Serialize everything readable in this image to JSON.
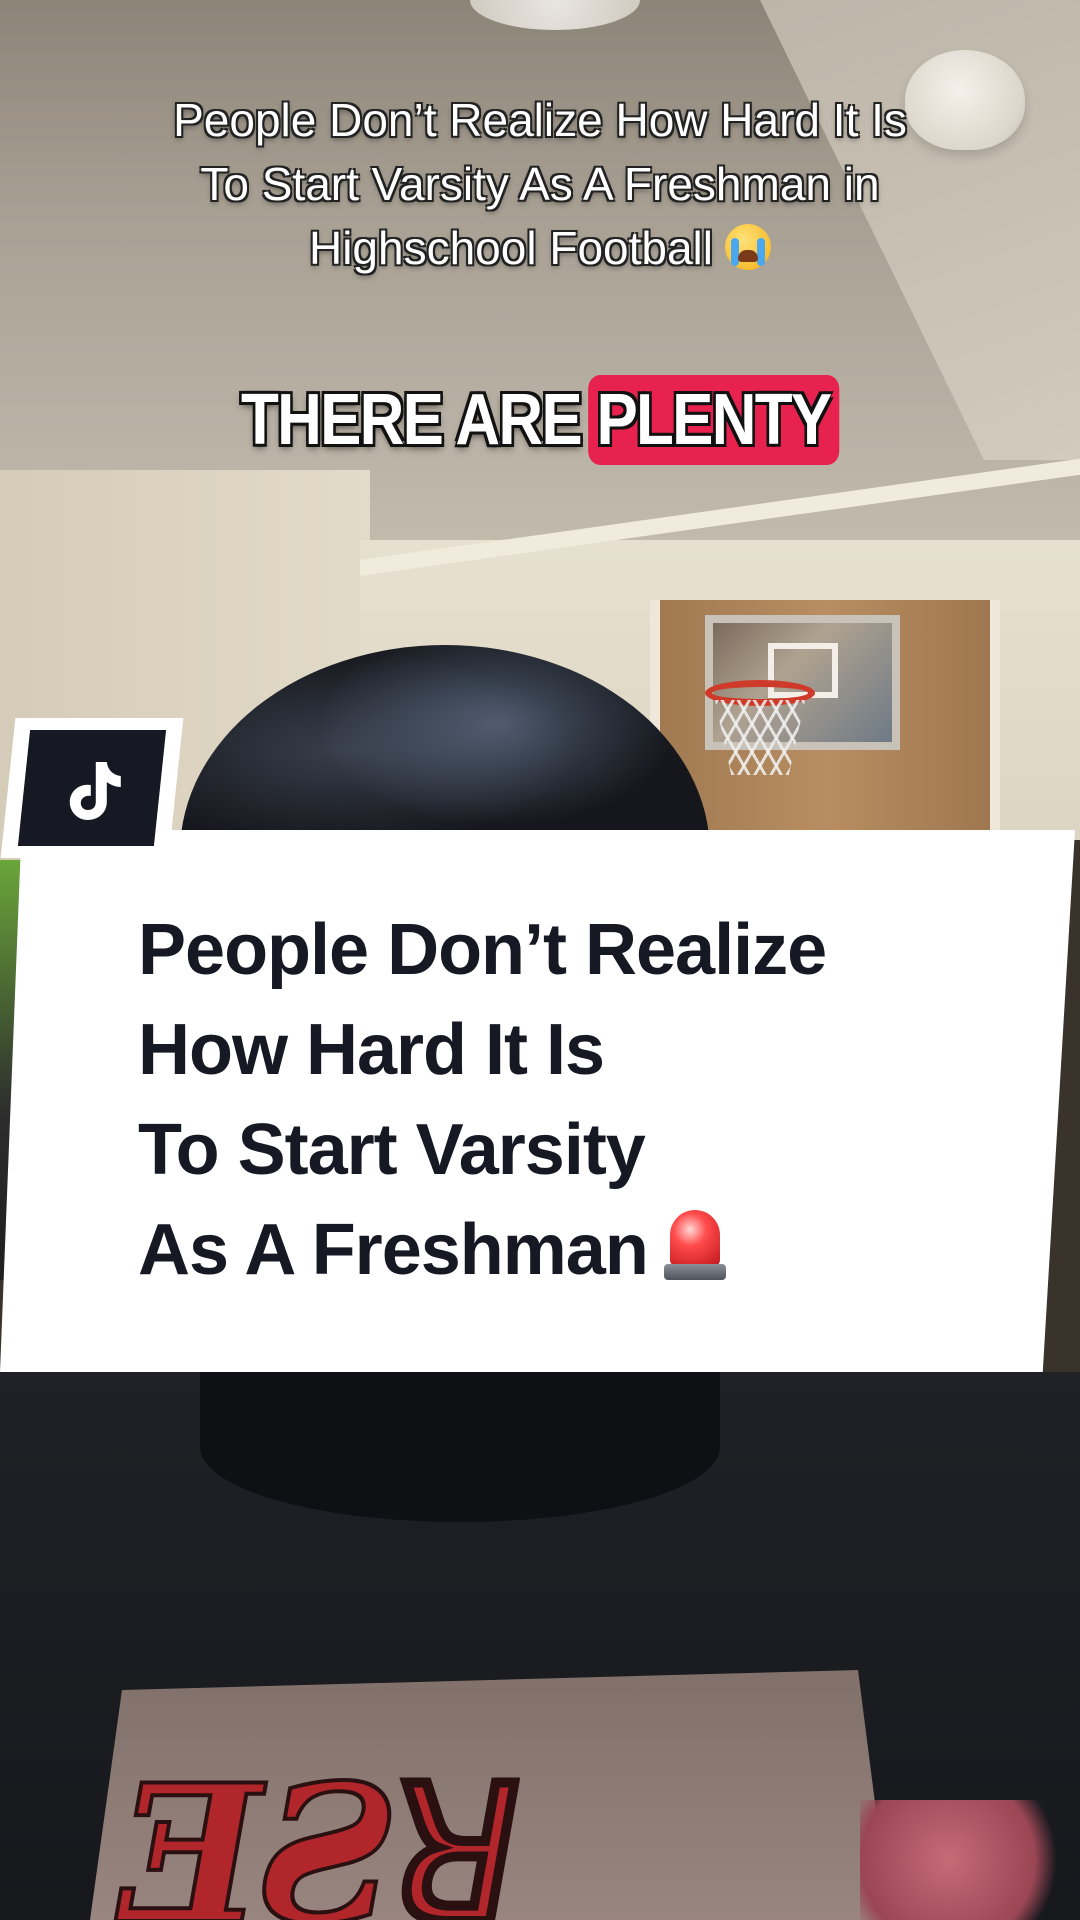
{
  "video": {
    "top_caption": {
      "line1": "People Don’t Realize How Hard It Is",
      "line2": "To Start Varsity As A Freshman in",
      "line3": "Highschool Football",
      "emoji": "loudly-crying-face-icon"
    },
    "subtitle": {
      "plain": "THERE ARE",
      "highlight": "PLENTY",
      "highlight_color": "#e8224f"
    },
    "tiktok_badge": {
      "icon": "tiktok-logo-icon",
      "background": "#161823"
    },
    "card": {
      "lines": [
        "People Don’t Realize",
        "How Hard It Is",
        "To Start Varsity",
        "As A Freshman"
      ],
      "emoji": "police-siren-icon",
      "text_color": "#161823",
      "background": "#ffffff"
    }
  }
}
